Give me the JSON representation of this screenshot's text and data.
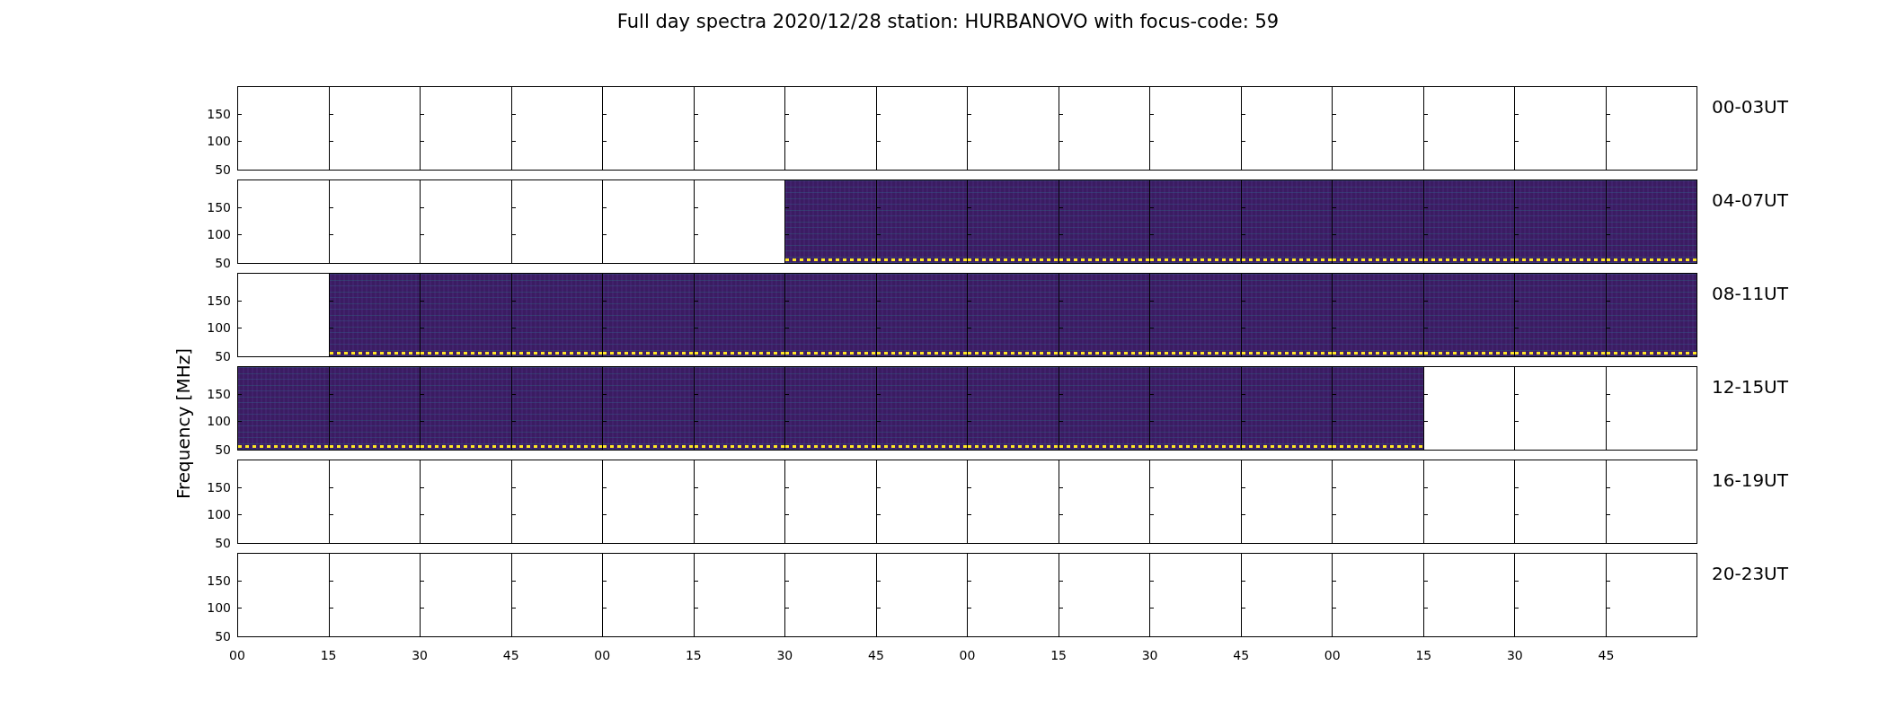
{
  "title": "Full day spectra 2020/12/28 station: HURBANOVO with focus-code: 59",
  "ylabel": "Frequency [MHz]",
  "rows": [
    {
      "label": "00-03UT",
      "yticks": [
        "150",
        "100",
        "50"
      ],
      "panels": [
        {
          "kind": "empty"
        },
        {
          "kind": "empty"
        },
        {
          "kind": "empty"
        },
        {
          "kind": "empty"
        },
        {
          "kind": "empty"
        },
        {
          "kind": "empty"
        },
        {
          "kind": "empty"
        },
        {
          "kind": "empty"
        },
        {
          "kind": "empty"
        },
        {
          "kind": "empty"
        },
        {
          "kind": "empty"
        },
        {
          "kind": "empty"
        },
        {
          "kind": "empty"
        },
        {
          "kind": "empty"
        },
        {
          "kind": "empty"
        },
        {
          "kind": "empty"
        }
      ]
    },
    {
      "label": "04-07UT",
      "yticks": [
        "150",
        "100",
        "50"
      ],
      "panels": [
        {
          "kind": "empty"
        },
        {
          "kind": "empty"
        },
        {
          "kind": "empty"
        },
        {
          "kind": "empty"
        },
        {
          "kind": "empty"
        },
        {
          "kind": "empty"
        },
        {
          "kind": "spectrum"
        },
        {
          "kind": "spectrum"
        },
        {
          "kind": "spectrum"
        },
        {
          "kind": "spectrum"
        },
        {
          "kind": "spectrum"
        },
        {
          "kind": "spectrum"
        },
        {
          "kind": "spectrum"
        },
        {
          "kind": "spectrum"
        },
        {
          "kind": "spectrum"
        },
        {
          "kind": "spectrum"
        }
      ]
    },
    {
      "label": "08-11UT",
      "yticks": [
        "150",
        "100",
        "50"
      ],
      "panels": [
        {
          "kind": "empty"
        },
        {
          "kind": "spectrum"
        },
        {
          "kind": "spectrum"
        },
        {
          "kind": "spectrum"
        },
        {
          "kind": "spectrum"
        },
        {
          "kind": "spectrum"
        },
        {
          "kind": "spectrum"
        },
        {
          "kind": "spectrum"
        },
        {
          "kind": "spectrum"
        },
        {
          "kind": "spectrum"
        },
        {
          "kind": "spectrum"
        },
        {
          "kind": "spectrum"
        },
        {
          "kind": "spectrum"
        },
        {
          "kind": "spectrum"
        },
        {
          "kind": "spectrum"
        },
        {
          "kind": "spectrum"
        }
      ]
    },
    {
      "label": "12-15UT",
      "yticks": [
        "150",
        "100",
        "50"
      ],
      "panels": [
        {
          "kind": "spectrum"
        },
        {
          "kind": "spectrum"
        },
        {
          "kind": "spectrum"
        },
        {
          "kind": "spectrum"
        },
        {
          "kind": "spectrum"
        },
        {
          "kind": "spectrum"
        },
        {
          "kind": "spectrum"
        },
        {
          "kind": "spectrum"
        },
        {
          "kind": "spectrum"
        },
        {
          "kind": "spectrum"
        },
        {
          "kind": "spectrum"
        },
        {
          "kind": "spectrum"
        },
        {
          "kind": "spectrum"
        },
        {
          "kind": "empty"
        },
        {
          "kind": "empty"
        },
        {
          "kind": "empty"
        }
      ]
    },
    {
      "label": "16-19UT",
      "yticks": [
        "150",
        "100",
        "50"
      ],
      "panels": [
        {
          "kind": "empty"
        },
        {
          "kind": "empty"
        },
        {
          "kind": "empty"
        },
        {
          "kind": "empty"
        },
        {
          "kind": "empty"
        },
        {
          "kind": "empty"
        },
        {
          "kind": "empty"
        },
        {
          "kind": "empty"
        },
        {
          "kind": "empty"
        },
        {
          "kind": "empty"
        },
        {
          "kind": "empty"
        },
        {
          "kind": "empty"
        },
        {
          "kind": "empty"
        },
        {
          "kind": "empty"
        },
        {
          "kind": "empty"
        },
        {
          "kind": "empty"
        }
      ]
    },
    {
      "label": "20-23UT",
      "yticks": [
        "150",
        "100",
        "50"
      ],
      "panels": [
        {
          "kind": "empty"
        },
        {
          "kind": "empty"
        },
        {
          "kind": "empty"
        },
        {
          "kind": "empty"
        },
        {
          "kind": "empty"
        },
        {
          "kind": "empty"
        },
        {
          "kind": "empty"
        },
        {
          "kind": "empty"
        },
        {
          "kind": "empty"
        },
        {
          "kind": "empty"
        },
        {
          "kind": "empty"
        },
        {
          "kind": "empty"
        },
        {
          "kind": "empty"
        },
        {
          "kind": "empty"
        },
        {
          "kind": "empty"
        },
        {
          "kind": "empty"
        }
      ]
    }
  ],
  "xticks": [
    "00",
    "15",
    "30",
    "45",
    "00",
    "15",
    "30",
    "45",
    "00",
    "15",
    "30",
    "45",
    "00",
    "15",
    "30",
    "45"
  ]
}
